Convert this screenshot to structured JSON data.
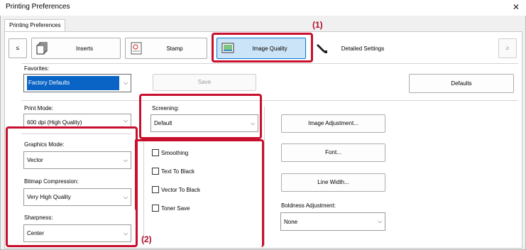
{
  "window": {
    "title": "Printing Preferences",
    "close_glyph": "✕"
  },
  "tabs": [
    {
      "label": "Printing Preferences"
    }
  ],
  "toolbar": {
    "prev_label": "≤",
    "next_label": "≥",
    "buttons": [
      {
        "label": "Inserts",
        "icon": "inserts-icon"
      },
      {
        "label": "Stamp",
        "icon": "stamp-icon"
      },
      {
        "label": "Image Quality",
        "icon": "image-quality-icon",
        "active": true
      },
      {
        "label": "Detailed Settings",
        "icon": "detailed-settings-icon"
      }
    ]
  },
  "favorites": {
    "label": "Favorites:",
    "value": "Factory Defaults",
    "save_label": "Save",
    "defaults_label": "Defaults"
  },
  "print_mode": {
    "label": "Print Mode:",
    "value": "600 dpi (High Quality)"
  },
  "screening": {
    "label": "Screening:",
    "value": "Default"
  },
  "graphics_mode": {
    "label": "Graphics Mode:",
    "value": "Vector"
  },
  "bitmap_compression": {
    "label": "Bitmap Compression:",
    "value": "Very High Quality"
  },
  "sharpness": {
    "label": "Sharpness:",
    "value": "Center"
  },
  "checkboxes": [
    {
      "label": "Smoothing",
      "checked": false
    },
    {
      "label": "Text To Black",
      "checked": false
    },
    {
      "label": "Vector To Black",
      "checked": false
    },
    {
      "label": "Toner Save",
      "checked": false
    }
  ],
  "side_buttons": {
    "image_adjustment": "Image Adjustment...",
    "font": "Font...",
    "line_width": "Line Width..."
  },
  "boldness": {
    "label": "Boldness Adjustment:",
    "value": "None"
  },
  "callouts": {
    "one": "(1)",
    "two": "(2)"
  },
  "colors": {
    "highlight": "#c8102e",
    "selection": "#0a64c6",
    "active_tab": "#cce4f7"
  }
}
